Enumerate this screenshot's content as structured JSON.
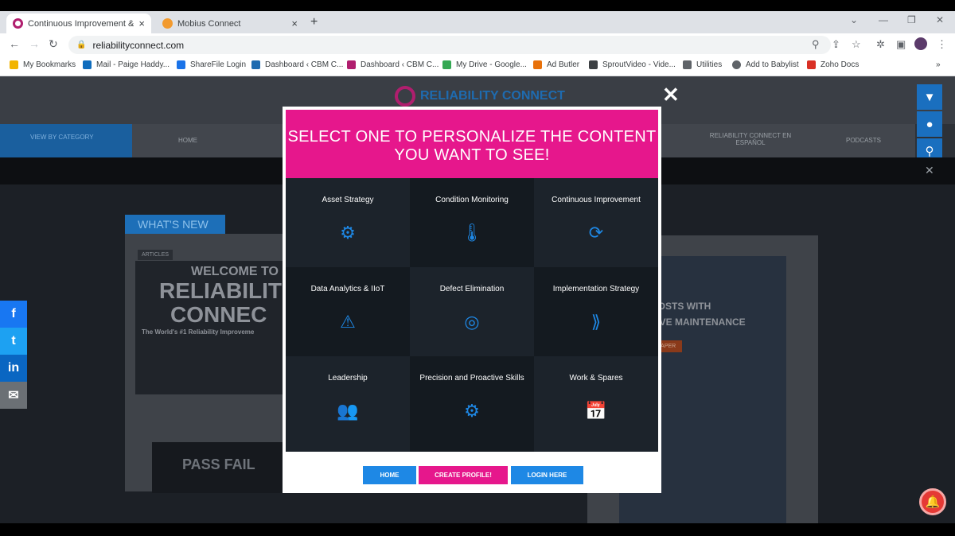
{
  "browser": {
    "tabs": [
      {
        "title": "Continuous Improvement & Asse",
        "color": "#b01e6e"
      },
      {
        "title": "Mobius Connect",
        "color": "#f29a2e"
      }
    ],
    "url": "reliabilityconnect.com",
    "bookmarks": [
      "My Bookmarks",
      "Mail - Paige Haddy...",
      "ShareFile Login",
      "Dashboard ‹ CBM C...",
      "Dashboard ‹ CBM C...",
      "My Drive - Google...",
      "Ad Butler",
      "SproutVideo - Vide...",
      "Utilities",
      "Add to Babylist",
      "Zoho Docs"
    ]
  },
  "site": {
    "logo": "RELIABILITY CONNECT",
    "category_label": "VIEW BY CATEGORY",
    "nav": [
      "HOME",
      "RELIABILITY CONNECT EN ESPAÑOL",
      "PODCASTS"
    ],
    "whats_new": "WHAT'S NEW",
    "article_tag": "ARTICLES",
    "card_title": [
      "WELCOME TO",
      "RELIABILIT",
      "CONNEC"
    ],
    "card_tagline": "The World's #1 Reliability Improveme",
    "passfail": "PASS FAIL",
    "ad_text": [
      "COSTS WITH",
      "TIVE MAINTENANCE"
    ],
    "ad_button": "PAPER"
  },
  "modal": {
    "heading": "SELECT ONE TO PERSONALIZE THE CONTENT YOU WANT TO SEE!",
    "options": [
      {
        "label": "Asset Strategy",
        "icon": "asset-strategy-icon",
        "glyph": "⚙"
      },
      {
        "label": "Condition Monitoring",
        "icon": "thermometer-icon",
        "glyph": "🌡"
      },
      {
        "label": "Continuous Improvement",
        "icon": "refresh-icon",
        "glyph": "⟳"
      },
      {
        "label": "Data Analytics & IIoT",
        "icon": "analytics-icon",
        "glyph": "⚠"
      },
      {
        "label": "Defect Elimination",
        "icon": "target-warning-icon",
        "glyph": "◎"
      },
      {
        "label": "Implementation Strategy",
        "icon": "implementation-icon",
        "glyph": "⟫"
      },
      {
        "label": "Leadership",
        "icon": "team-icon",
        "glyph": "👥"
      },
      {
        "label": "Precision and Proactive Skills",
        "icon": "precision-icon",
        "glyph": "⚙"
      },
      {
        "label": "Work & Spares",
        "icon": "calendar-tools-icon",
        "glyph": "📅"
      }
    ],
    "buttons": {
      "home": "HOME",
      "create_profile": "CREATE PROFILE!",
      "login": "LOGIN HERE"
    },
    "colors": {
      "pink": "#e6178c",
      "blue": "#1e88e5"
    }
  }
}
